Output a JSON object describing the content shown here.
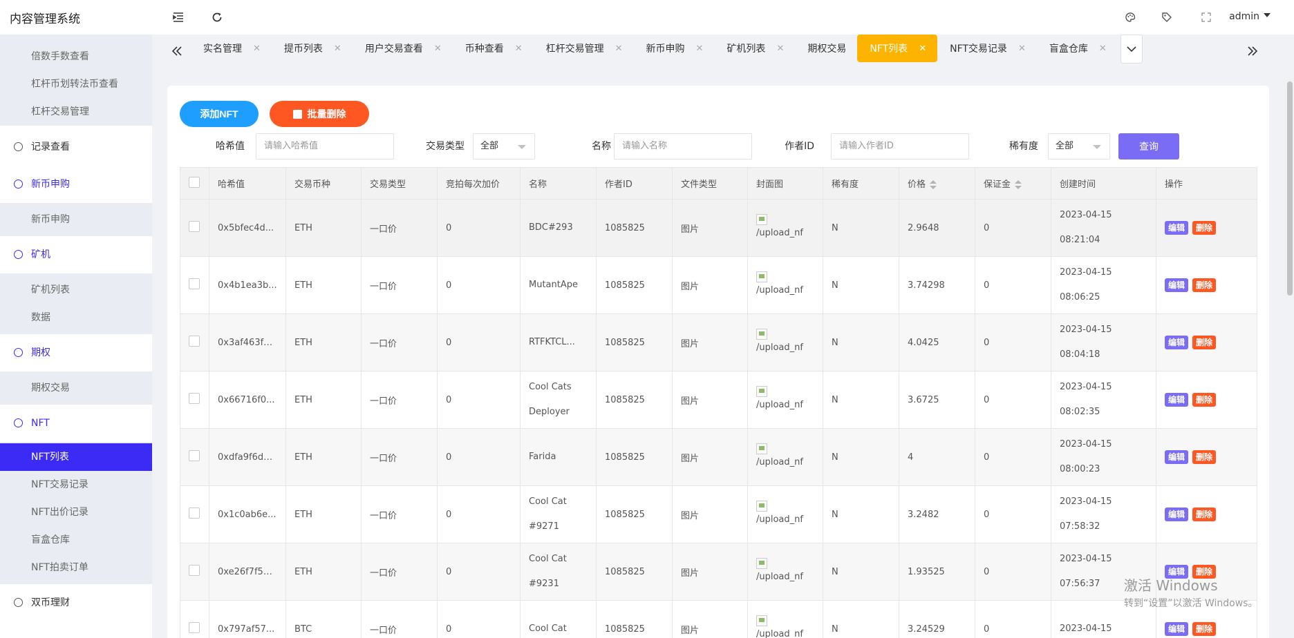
{
  "app": {
    "title": "内容管理系统",
    "user": "admin"
  },
  "topbar": {
    "collapse_icon": "menu-fold-icon",
    "refresh_icon": "refresh-icon",
    "theme_icon": "palette-icon",
    "tag_icon": "tag-icon",
    "fullscreen_icon": "fullscreen-icon"
  },
  "sidebar": {
    "group1": [
      "倍数手数查看",
      "杠杆币划转法币查看",
      "杠杆交易管理"
    ],
    "records": "记录查看",
    "newcoin": "新币申购",
    "newcoin_sub": [
      "新币申购"
    ],
    "miner": "矿机",
    "miner_sub": [
      "矿机列表",
      "数据"
    ],
    "options": "期权",
    "options_sub": [
      "期权交易"
    ],
    "nft": "NFT",
    "nft_sub": [
      "NFT列表",
      "NFT交易记录",
      "NFT出价记录",
      "盲盒仓库",
      "NFT拍卖订单"
    ],
    "dual": "双币理财"
  },
  "tabs": [
    "实名管理",
    "提币列表",
    "用户交易查看",
    "币种查看",
    "杠杆交易管理",
    "新币申购",
    "矿机列表",
    "期权交易",
    "NFT列表",
    "NFT交易记录",
    "盲盒仓库"
  ],
  "active_tab": "NFT列表",
  "actions": {
    "add": "添加NFT",
    "batch_delete": "批量删除",
    "query": "查询"
  },
  "filters": {
    "hash_label": "哈希值",
    "hash_placeholder": "请输入哈希值",
    "type_label": "交易类型",
    "type_value": "全部",
    "name_label": "名称",
    "name_placeholder": "请输入名称",
    "author_label": "作者ID",
    "author_placeholder": "请输入作者ID",
    "rarity_label": "稀有度",
    "rarity_value": "全部"
  },
  "table": {
    "headers": [
      "哈希值",
      "交易币种",
      "交易类型",
      "竞拍每次加价",
      "名称",
      "作者ID",
      "文件类型",
      "封面图",
      "稀有度",
      "价格",
      "保证金",
      "创建时间",
      "操作"
    ],
    "edit_label": "编辑",
    "delete_label": "删除",
    "rows": [
      {
        "hash": "0x5bfec4d...",
        "coin": "ETH",
        "type": "一口价",
        "inc": "0",
        "name1": "BDC#293",
        "name2": "",
        "author": "1085825",
        "file": "图片",
        "cover": "/upload_nf",
        "rarity": "N",
        "price": "2.9648",
        "deposit": "0",
        "date": "2023-04-15",
        "time": "08:21:04"
      },
      {
        "hash": "0x4b1ea3b...",
        "coin": "ETH",
        "type": "一口价",
        "inc": "0",
        "name1": "MutantApe",
        "name2": "",
        "author": "1085825",
        "file": "图片",
        "cover": "/upload_nf",
        "rarity": "N",
        "price": "3.74298",
        "deposit": "0",
        "date": "2023-04-15",
        "time": "08:06:25"
      },
      {
        "hash": "0x3af463f9...",
        "coin": "ETH",
        "type": "一口价",
        "inc": "0",
        "name1": "RTFKTCL...",
        "name2": "",
        "author": "1085825",
        "file": "图片",
        "cover": "/upload_nf",
        "rarity": "N",
        "price": "4.0425",
        "deposit": "0",
        "date": "2023-04-15",
        "time": "08:04:18"
      },
      {
        "hash": "0x66716f0...",
        "coin": "ETH",
        "type": "一口价",
        "inc": "0",
        "name1": "Cool Cats",
        "name2": "Deployer",
        "author": "1085825",
        "file": "图片",
        "cover": "/upload_nf",
        "rarity": "N",
        "price": "3.6725",
        "deposit": "0",
        "date": "2023-04-15",
        "time": "08:02:35"
      },
      {
        "hash": "0xdfa9f6d0...",
        "coin": "ETH",
        "type": "一口价",
        "inc": "0",
        "name1": "Farida",
        "name2": "",
        "author": "1085825",
        "file": "图片",
        "cover": "/upload_nf",
        "rarity": "N",
        "price": "4",
        "deposit": "0",
        "date": "2023-04-15",
        "time": "08:00:23"
      },
      {
        "hash": "0x1c0ab6e...",
        "coin": "ETH",
        "type": "一口价",
        "inc": "0",
        "name1": "Cool Cat",
        "name2": "#9271",
        "author": "1085825",
        "file": "图片",
        "cover": "/upload_nf",
        "rarity": "N",
        "price": "3.2482",
        "deposit": "0",
        "date": "2023-04-15",
        "time": "07:58:32"
      },
      {
        "hash": "0xe26f7f55...",
        "coin": "ETH",
        "type": "一口价",
        "inc": "0",
        "name1": "Cool Cat",
        "name2": "#9231",
        "author": "1085825",
        "file": "图片",
        "cover": "/upload_nf",
        "rarity": "N",
        "price": "1.93525",
        "deposit": "0",
        "date": "2023-04-15",
        "time": "07:56:37"
      },
      {
        "hash": "0x797af57...",
        "coin": "BTC",
        "type": "一口价",
        "inc": "0",
        "name1": "Cool Cat",
        "name2": "",
        "author": "1085825",
        "file": "图片",
        "cover": "/upload_nf",
        "rarity": "N",
        "price": "3.24529",
        "deposit": "0",
        "date": "2023-04-15",
        "time": ""
      }
    ]
  },
  "watermark": {
    "line1": "激活 Windows",
    "line2": "转到“设置”以激活 Windows。"
  }
}
